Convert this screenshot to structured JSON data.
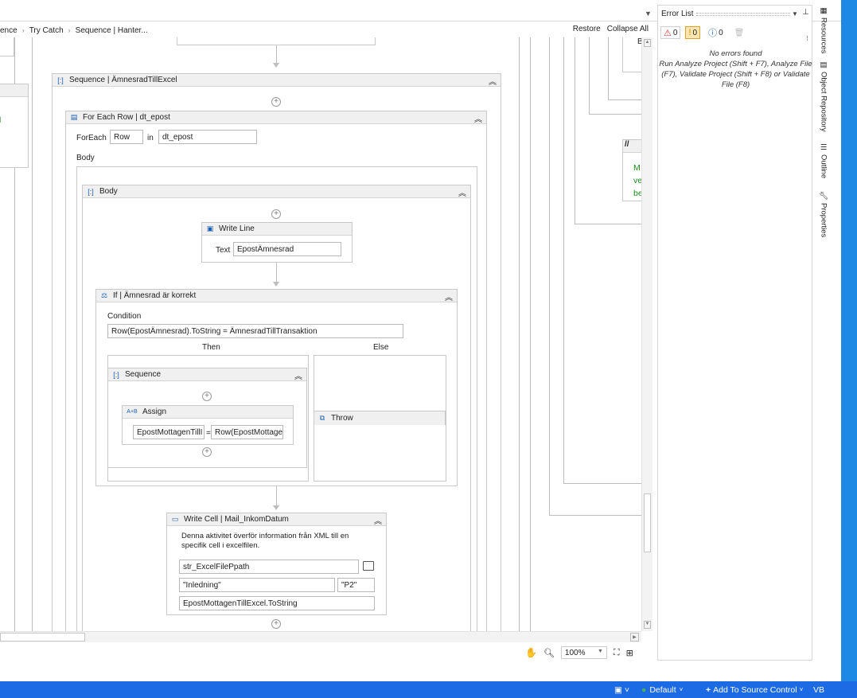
{
  "breadcrumbs": [
    "ence",
    "Try Catch",
    "Sequence | Hanter..."
  ],
  "toolbar": {
    "restore": "Restore",
    "collapse_all": "Collapse All"
  },
  "outer_sequence": {
    "title": "Sequence | ÄmnesradTillExcel"
  },
  "foreach": {
    "title": "For Each Row | dt_epost",
    "foreach_label": "ForEach",
    "item_value": "Row",
    "in_label": "in",
    "collection_value": "dt_epost",
    "body_label": "Body"
  },
  "body_seq": {
    "title": "Body"
  },
  "writeline": {
    "title": "Write Line",
    "text_label": "Text",
    "text_value": "EpostÄmnesrad"
  },
  "if_block": {
    "title": "If | Ämnesrad är korrekt",
    "condition_label": "Condition",
    "condition_value": "Row(EpostÄmnesrad).ToString = ÄmnesradTillTransaktion",
    "then_label": "Then",
    "else_label": "Else"
  },
  "then_seq": {
    "title": "Sequence"
  },
  "assign": {
    "title": "Assign",
    "left_value": "EpostMottagenTillI",
    "eq": "=",
    "right_value": "Row(EpostMottage"
  },
  "throw": {
    "title": "Throw"
  },
  "writecell": {
    "title": "Write Cell | Mail_InkomDatum",
    "description": "Denna aktivitet överför information från XML till en specifik cell i excelfilen.",
    "path_value": "str_ExcelFilePpath",
    "sheet_value": "\"Inledning\"",
    "cell_value": "\"P2\"",
    "value_value": "EpostMottagenTillExcel.ToString"
  },
  "right_partial": {
    "b_label": "B",
    "comment_lines": [
      "M",
      "ve",
      "be"
    ],
    "comment_icon": "//"
  },
  "zoom": {
    "value": "100%"
  },
  "error_list": {
    "title": "Error List",
    "errors": "0",
    "warnings": "0",
    "messages": "0",
    "message": "No errors found",
    "hint": "Run Analyze Project (Shift + F7), Analyze File (F7), Validate Project (Shift + F8) or Validate File (F8)"
  },
  "side_tabs": [
    "Resources",
    "Object Repository",
    "Outline",
    "Properties"
  ],
  "status": {
    "default": "Default",
    "source_control": "Add To Source Control",
    "vb": "VB"
  },
  "colors": {
    "accent": "#1d6ae5",
    "comment_green": "#1a8a1a"
  }
}
